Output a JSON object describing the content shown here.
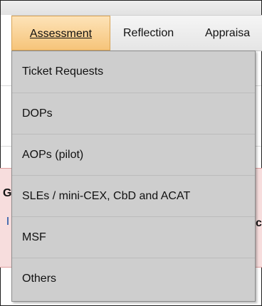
{
  "navbar": {
    "tabs": [
      {
        "label": "Assessment",
        "active": true
      },
      {
        "label": "Reflection",
        "active": false
      },
      {
        "label": "Appraisa",
        "active": false
      }
    ]
  },
  "dropdown": {
    "items": [
      {
        "label": "Ticket Requests"
      },
      {
        "label": "DOPs"
      },
      {
        "label": "AOPs (pilot)"
      },
      {
        "label": "SLEs / mini-CEX, CbD and ACAT"
      },
      {
        "label": "MSF"
      },
      {
        "label": "Others"
      }
    ]
  },
  "background": {
    "partial_left_char": "G",
    "partial_right_char": "c"
  },
  "colors": {
    "active_tab": "#f6c47a",
    "menu_bg": "#cecece",
    "alert_bg": "#f7dddd",
    "alert_border": "#df9e9e"
  }
}
